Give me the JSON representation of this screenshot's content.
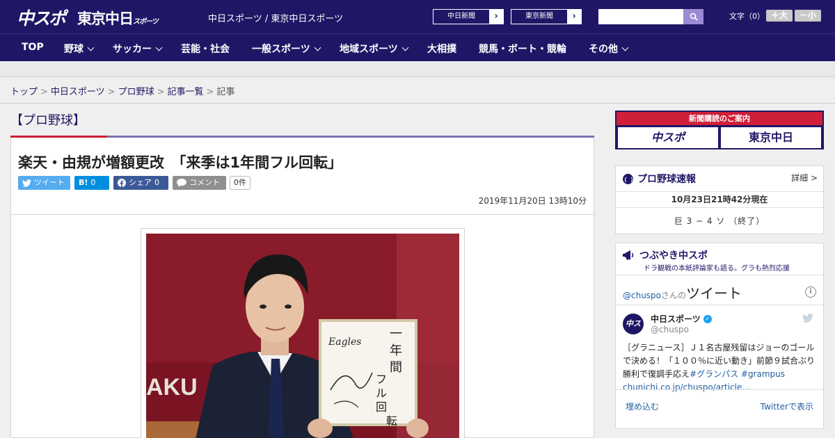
{
  "header": {
    "logo_chuspo": "中スポ",
    "logo_tokyo": "東京中日",
    "logo_tokyo_sub": "スポーツ",
    "tagline": "中日スポーツ / 東京中日スポーツ",
    "paper_buttons": [
      "中日新聞",
      "東京新聞"
    ],
    "search_placeholder": "",
    "font_label": "文字（0）",
    "font_larger": "＋大",
    "font_smaller": "－小"
  },
  "nav": {
    "items": [
      {
        "label": "TOP",
        "dropdown": false
      },
      {
        "label": "野球",
        "dropdown": true
      },
      {
        "label": "サッカー",
        "dropdown": true
      },
      {
        "label": "芸能・社会",
        "dropdown": false
      },
      {
        "label": "一般スポーツ",
        "dropdown": true
      },
      {
        "label": "地域スポーツ",
        "dropdown": true
      },
      {
        "label": "大相撲",
        "dropdown": false
      },
      {
        "label": "競馬・ボート・競輪",
        "dropdown": false
      },
      {
        "label": "その他",
        "dropdown": true
      }
    ]
  },
  "breadcrumb": {
    "items": [
      "トップ",
      "中日スポーツ",
      "プロ野球",
      "記事一覧"
    ],
    "current": "記事"
  },
  "article": {
    "section": "【プロ野球】",
    "headline": "楽天・由規が増額更改　「来季は1年間フル回転」",
    "share": {
      "tweet": "ツイート",
      "hatena": "B!",
      "hatena_count": "0",
      "facebook": "シェア",
      "facebook_count": "0",
      "comment": "コメント",
      "comment_count": "0件"
    },
    "date": "2019年11月20日 13時10分"
  },
  "sidebar": {
    "ad": {
      "top": "新聞購読のご案内",
      "btn1": "中スポ",
      "btn2": "東京中日"
    },
    "baseball": {
      "title": "プロ野球速報",
      "detail": "詳細 >",
      "updated": "10月23日21時42分現在",
      "score": "巨 3 − 4 ソ （終了）"
    },
    "twitter": {
      "title": "つぶやき中スポ",
      "subtitle": "ドラ観戦の本紙評論家も語る。グラも熱烈応援",
      "handle_prefix": "@chuspo",
      "handle_mid": "さんの",
      "tweets_word": "ツイート",
      "account_name": "中日スポーツ",
      "account_handle": "@chuspo",
      "tweet_text": "［グラニュース］Ｊ１名古屋残留はジョーのゴールで決める！「１００％に近い動き」前節９試合ぶり勝利で復調手応え",
      "tweet_tags": "#グランパス #grampus",
      "tweet_link": "chunichi.co.jp/chuspo/article…",
      "embed": "埋め込む",
      "view_on": "Twitterで表示"
    }
  }
}
